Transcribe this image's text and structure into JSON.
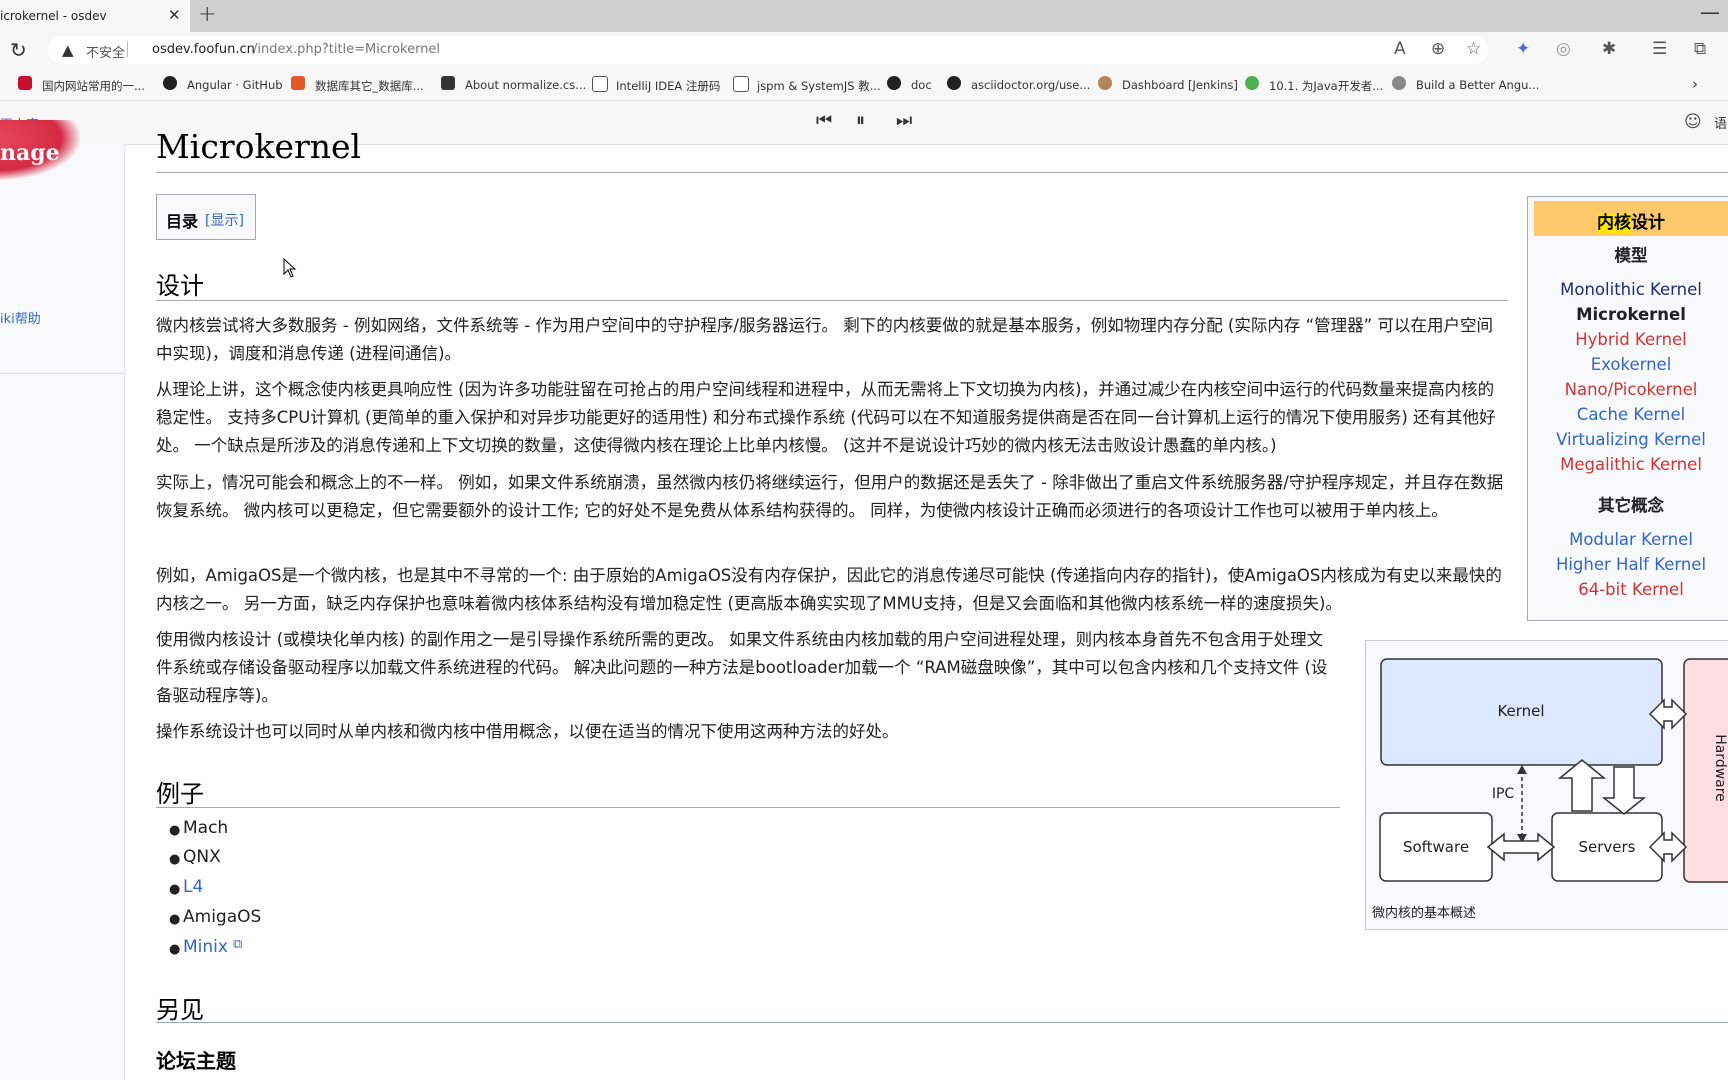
{
  "browser": {
    "tab_title": "icrokernel - osdev",
    "tab_close": "✕",
    "new_tab": "+",
    "url_security": "不安全",
    "url_host": "osdev.foofun.cn",
    "url_path": "/index.php?title=Microkernel",
    "bookmarks": [
      "国内网站常用的一...",
      "Angular · GitHub",
      "数据库其它_数据库...",
      "About normalize.cs...",
      "IntelliJ IDEA 注册码",
      "jspm & SystemJS 教...",
      "doc",
      "asciidoctor.org/use...",
      "Dashboard [Jenkins]",
      "10.1. 为Java开发者...",
      "Build a Better Angu..."
    ],
    "skip_link": "页内容",
    "lang_label": "语"
  },
  "sidebar": {
    "logo_text": "nage",
    "help_link": "iki帮助"
  },
  "article": {
    "title": "Microkernel",
    "toc_title": "目录",
    "toc_toggle": "[显示]",
    "design_heading": "设计",
    "design_paragraphs": [
      "微内核尝试将大多数服务 - 例如网络，文件系统等 - 作为用户空间中的守护程序/服务器运行。 剩下的内核要做的就是基本服务，例如物理内存分配 (实际内存 “管理器” 可以在用户空间中实现)，调度和消息传递 (进程间通信)。",
      "从理论上讲，这个概念使内核更具响应性 (因为许多功能驻留在可抢占的用户空间线程和进程中，从而无需将上下文切换为内核)，并通过减少在内核空间中运行的代码数量来提高内核的稳定性。 支持多CPU计算机 (更简单的重入保护和对异步功能更好的适用性) 和分布式操作系统 (代码可以在不知道服务提供商是否在同一台计算机上运行的情况下使用服务) 还有其他好处。 一个缺点是所涉及的消息传递和上下文切换的数量，这使得微内核在理论上比单内核慢。 (这并不是说设计巧妙的微内核无法击败设计愚蠢的单内核。)",
      "实际上，情况可能会和概念上的不一样。 例如，如果文件系统崩溃，虽然微内核仍将继续运行，但用户的数据还是丢失了 - 除非做出了重启文件系统服务器/守护程序规定，并且存在数据恢复系统。 微内核可以更稳定，但它需要额外的设计工作; 它的好处不是免费从体系结构获得的。 同样，为使微内核设计正确而必须进行的各项设计工作也可以被用于单内核上。",
      "例如，AmigaOS是一个微内核，也是其中不寻常的一个: 由于原始的AmigaOS没有内存保护，因此它的消息传递尽可能快 (传递指向内存的指针)，使AmigaOS内核成为有史以来最快的内核之一。 另一方面，缺乏内存保护也意味着微内核体系结构没有增加稳定性 (更高版本确实实现了MMU支持，但是又会面临和其他微内核系统一样的速度损失)。",
      "使用微内核设计 (或模块化单内核) 的副作用之一是引导操作系统所需的更改。 如果文件系统由内核加载的用户空间进程处理，则内核本身首先不包含用于处理文件系统或存储设备驱动程序以加载文件系统进程的代码。 解决此问题的一种方法是bootloader加载一个 “RAM磁盘映像”，其中可以包含内核和几个支持文件 (设备驱动程序等)。",
      "操作系统设计也可以同时从单内核和微内核中借用概念，以便在适当的情况下使用这两种方法的好处。"
    ],
    "examples_heading": "例子",
    "examples": [
      "Mach",
      "QNX",
      "L4",
      "AmigaOS",
      "Minix"
    ],
    "see_also_heading": "另见",
    "forum_heading": "论坛主题"
  },
  "navbox": {
    "title_part1": "内核",
    "title_part2": "设计",
    "models_heading": "模型",
    "models": [
      "Monolithic Kernel",
      "Microkernel",
      "Hybrid Kernel",
      "Exokernel",
      "Nano/Picokernel",
      "Cache Kernel",
      "Virtualizing Kernel",
      "Megalithic Kernel"
    ],
    "other_heading": "其它概念",
    "other": [
      "Modular Kernel",
      "Higher Half Kernel",
      "64-bit Kernel"
    ]
  },
  "diagram": {
    "kernel": "Kernel",
    "ipc": "IPC",
    "software": "Software",
    "servers": "Servers",
    "hardware": "Hardware",
    "caption": "微内核的基本概述"
  },
  "colors": {
    "link_blue": "#3366cc",
    "link_dark": "#1f2b7a",
    "link_red": "#d33333",
    "navbox_header": "#ffc96b",
    "highlight": "#ffe600",
    "kernel_fill": "#dbe8ff",
    "hardware_fill": "#ffdde3"
  }
}
